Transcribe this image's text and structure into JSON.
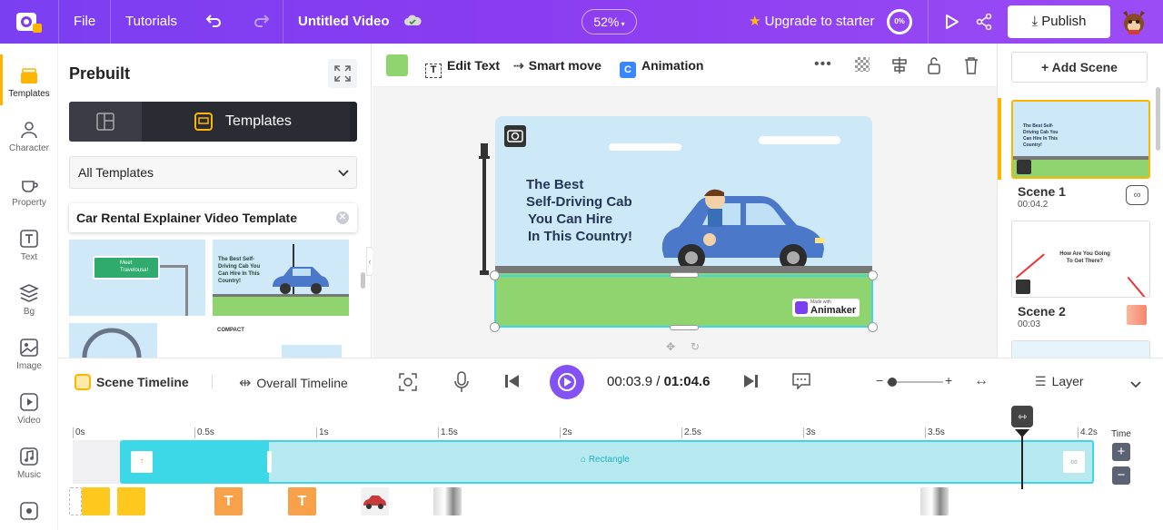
{
  "topbar": {
    "file": "File",
    "tutorials": "Tutorials",
    "title": "Untitled Video",
    "zoom": "52%",
    "upgrade": "Upgrade to starter",
    "progress": "0%",
    "publish": "Publish"
  },
  "rail": {
    "items": [
      {
        "label": "Templates"
      },
      {
        "label": "Character"
      },
      {
        "label": "Property"
      },
      {
        "label": "Text"
      },
      {
        "label": "Bg"
      },
      {
        "label": "Image"
      },
      {
        "label": "Video"
      },
      {
        "label": "Music"
      }
    ]
  },
  "panel": {
    "title": "Prebuilt",
    "tab_templates": "Templates",
    "dropdown": "All Templates",
    "search_value": "Car Rental Explainer Video Template",
    "thumb1_text": "Meet Travelousa!",
    "thumb2_text": "The Best Self-Driving Cab You Can Hire In This Country!",
    "thumb4_text": "COMPACT"
  },
  "toolbar": {
    "edit_text": "Edit Text",
    "smart_move": "Smart move",
    "animation": "Animation",
    "color": "#8fd46f"
  },
  "canvas": {
    "headline": [
      "The Best",
      "Self-Driving Cab",
      "You Can Hire",
      "In This Country!"
    ],
    "watermark_small": "Made with",
    "watermark": "Animaker"
  },
  "scenes": {
    "add": "+ Add Scene",
    "items": [
      {
        "name": "Scene 1",
        "time": "00:04.2",
        "thumb": "The Best Self-Driving Cab You Can Hire In This Country!"
      },
      {
        "name": "Scene 2",
        "time": "00:03",
        "thumb": "How Are You Going To Get There?"
      }
    ]
  },
  "timeline": {
    "scene_tab": "Scene Timeline",
    "overall_tab": "Overall Timeline",
    "current": "00:03.9",
    "sep": "/",
    "total": "01:04.6",
    "layer": "Layer",
    "time": "Time",
    "ticks": [
      "0s",
      "0.5s",
      "1s",
      "1.5s",
      "2s",
      "2.5s",
      "3s",
      "3.5s",
      "4.2s"
    ],
    "track_label": "Rectangle",
    "progress_fraction": 0.93
  },
  "colors": {
    "accent": "#7b3ff2",
    "play": "#8452f4",
    "track": "#b6e9f0",
    "track_dark": "#3cd8e8",
    "ground": "#8fd46f",
    "sky": "#cde8f6"
  }
}
